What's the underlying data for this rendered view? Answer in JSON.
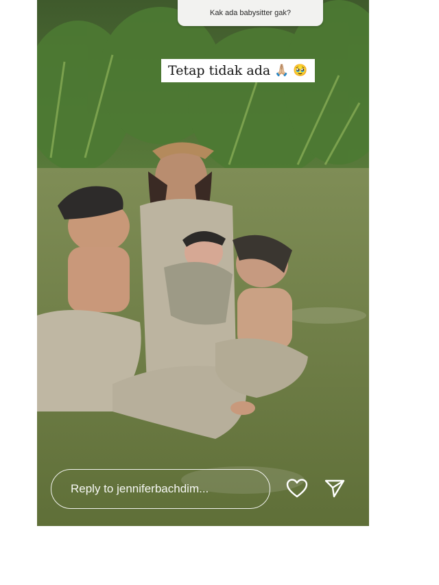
{
  "story": {
    "question_sticker_text": "Kak ada babysitter gak?",
    "answer_text": "Tetap tidak ada",
    "answer_emojis": [
      "🙏🏼",
      "🥹"
    ],
    "photo_description": "family photo"
  },
  "reply": {
    "placeholder": "Reply to jenniferbachdim..."
  },
  "icons": {
    "like": "heart-icon",
    "share": "send-icon"
  }
}
